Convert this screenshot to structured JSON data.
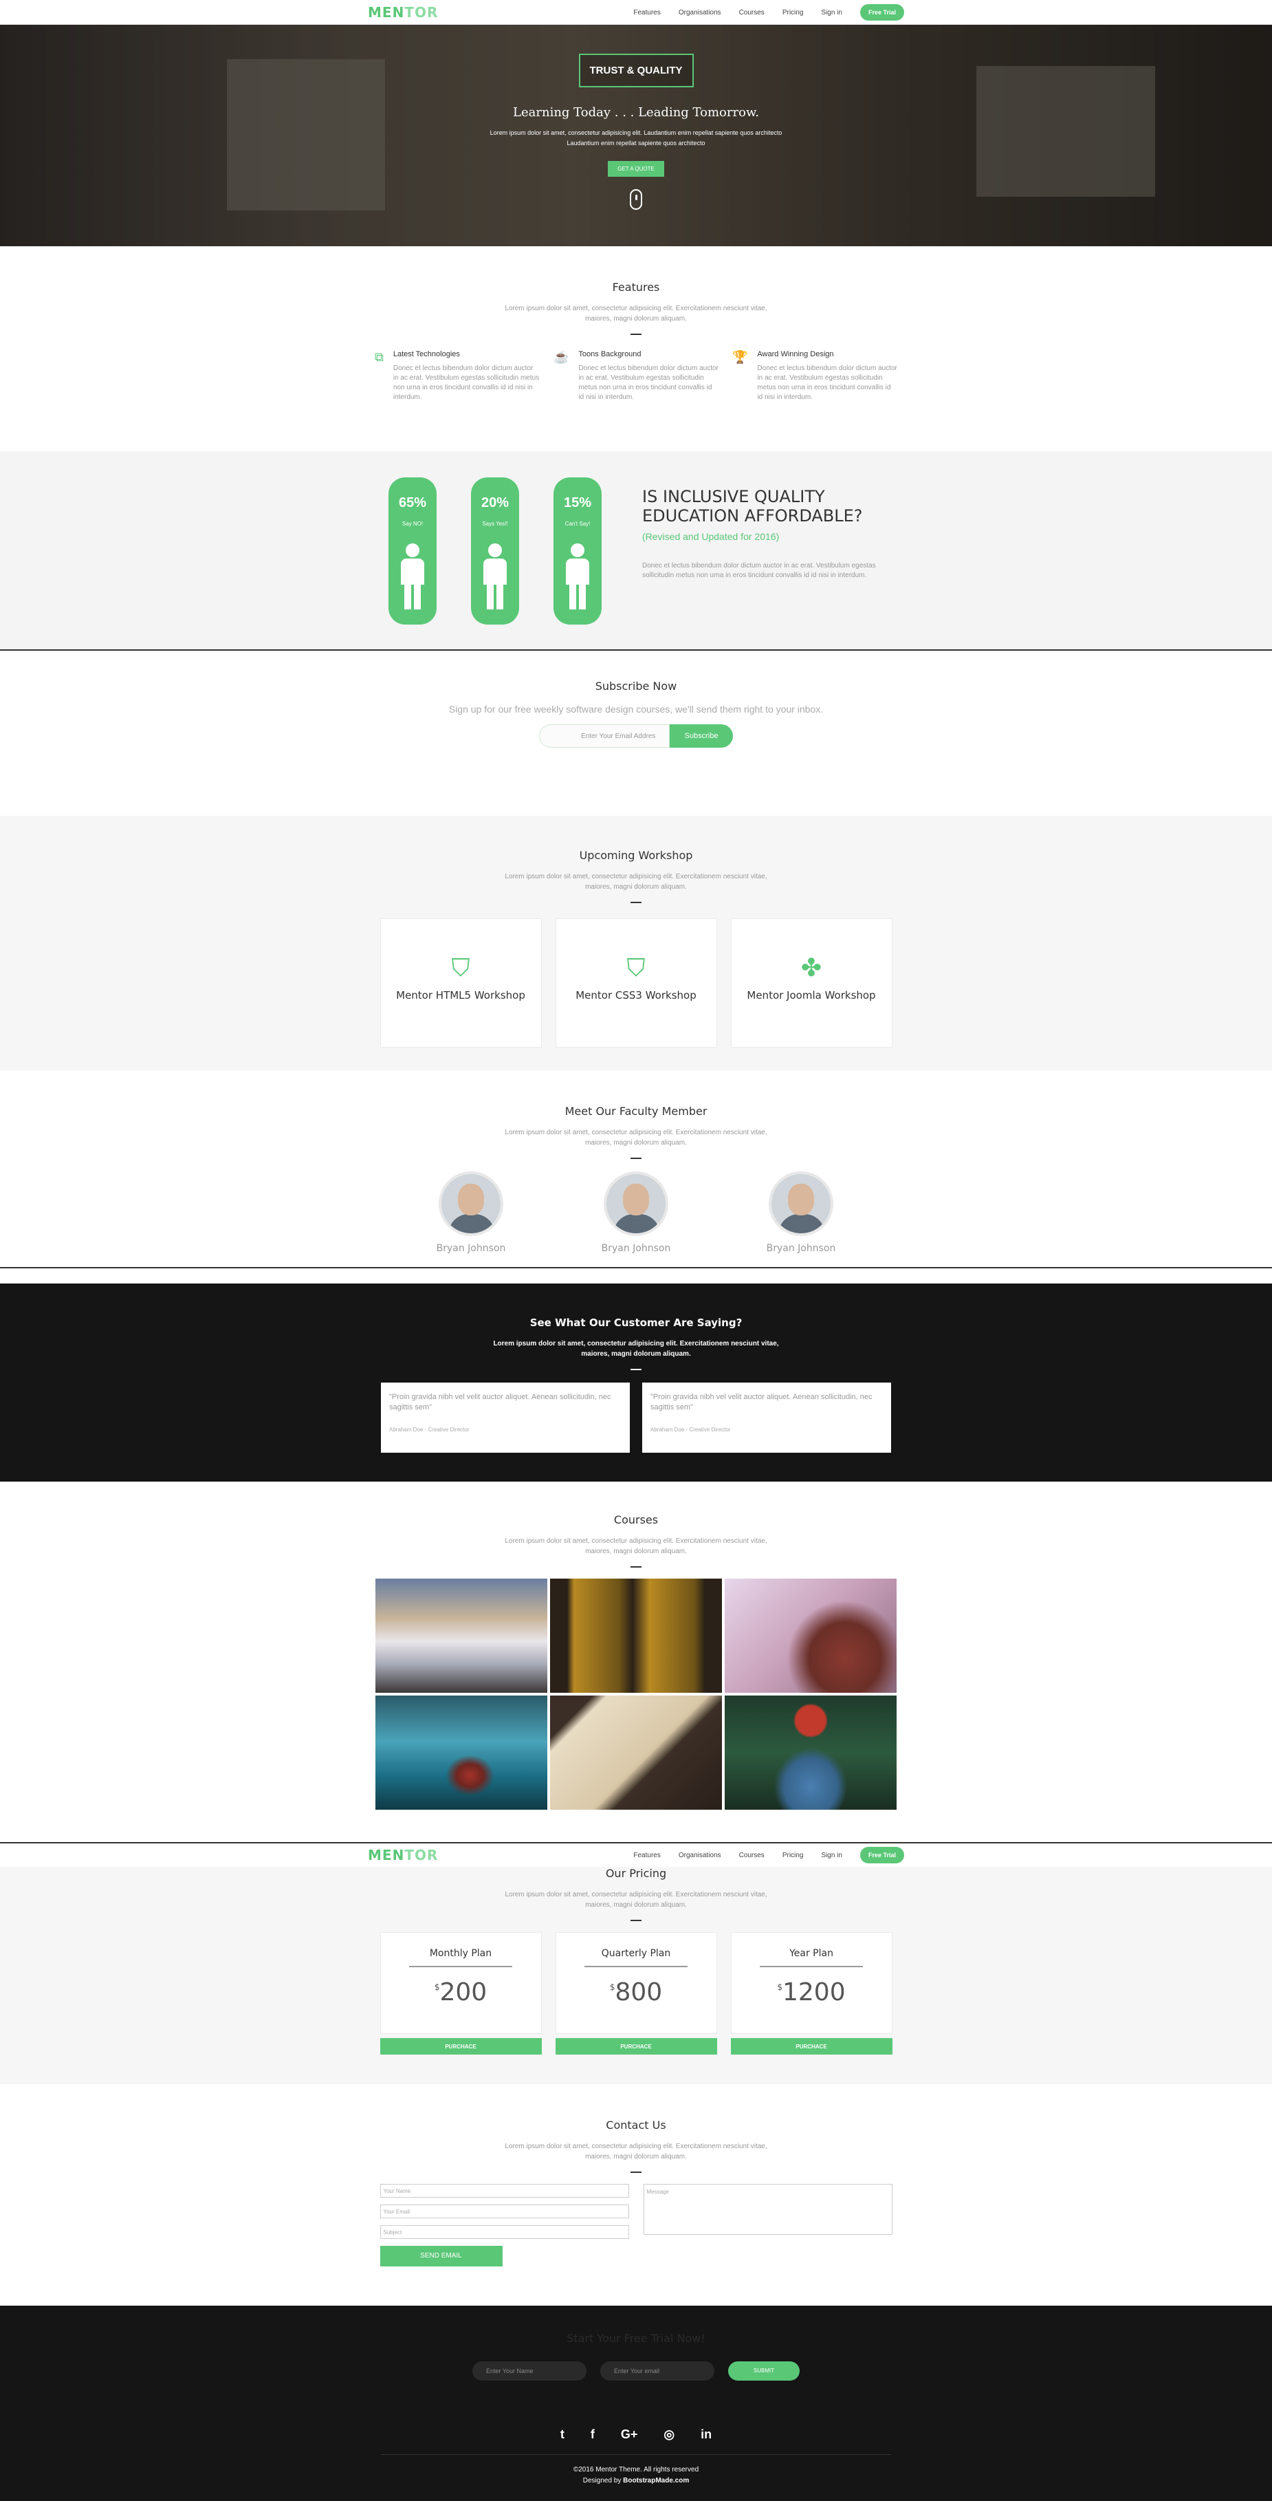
{
  "nav": {
    "logo_a": "MEN",
    "logo_b": "TOR",
    "items": [
      "Features",
      "Organisations",
      "Courses",
      "Pricing",
      "Sign in"
    ],
    "cta": "Free Trial"
  },
  "hero": {
    "badge": "TRUST & QUALITY",
    "headline": "Learning Today . . . Leading Tomorrow.",
    "text1": "Lorem ipsum dolor sit amet, consectetur adipisicing elit. Laudantium enim repellat sapiente quos architecto",
    "text2": "Laudantium enim repellat sapiente quos architecto",
    "button": "GET A QUOTE"
  },
  "features": {
    "title": "Features",
    "sub1": "Lorem ipsum dolor sit amet, consectetur adipisicing elit. Exercitationem nesciunt vitae,",
    "sub2": "maiores, magni dolorum aliquam.",
    "items": [
      {
        "icon": "css3-icon",
        "title": "Latest Technologies",
        "text": "Donec et lectus bibendum dolor dictum auctor in ac erat. Vestibulum egestas sollicitudin metus non urna in eros tincidunt convallis id id nisi in interdum."
      },
      {
        "icon": "drink-icon",
        "title": "Toons Background",
        "text": "Donec et lectus bibendum dolor dictum auctor in ac erat. Vestibulum egestas sollicitudin metus non urna in eros tincidunt convallis id id nisi in interdum."
      },
      {
        "icon": "trophy-icon",
        "title": "Award Winning Design",
        "text": "Donec et lectus bibendum dolor dictum auctor in ac erat. Vestibulum egestas sollicitudin metus non urna in eros tincidunt convallis id id nisi in interdum."
      }
    ]
  },
  "stats": {
    "items": [
      {
        "pct": "65%",
        "label": "Say NO!"
      },
      {
        "pct": "20%",
        "label": "Says Yes!!"
      },
      {
        "pct": "15%",
        "label": "Can't Say!"
      }
    ],
    "heading1": "IS INCLUSIVE QUALITY",
    "heading2": "EDUCATION AFFORDABLE?",
    "sub": "(Revised and Updated for 2016)",
    "text": "Donec et lectus bibendum dolor dictum auctor in ac erat. Vestibulum egestas sollicitudin metus non urna in eros tincidunt convallis id id nisi in interdum."
  },
  "subscribe": {
    "title": "Subscribe Now",
    "lead": "Sign up for our free weekly software design courses, we'll send them right to your inbox.",
    "placeholder": "Enter Your Email Addres",
    "button": "Subscribe"
  },
  "workshop": {
    "title": "Upcoming Workshop",
    "sub1": "Lorem ipsum dolor sit amet, consectetur adipisicing elit. Exercitationem nesciunt vitae,",
    "sub2": "maiores, magni dolorum aliquam.",
    "cards": [
      {
        "icon": "html5-icon",
        "title": "Mentor HTML5 Workshop"
      },
      {
        "icon": "css3-icon",
        "title": "Mentor CSS3 Workshop"
      },
      {
        "icon": "joomla-icon",
        "title": "Mentor Joomla Workshop"
      }
    ]
  },
  "faculty": {
    "title": "Meet Our Faculty Member",
    "sub1": "Lorem ipsum dolor sit amet, consectetur adipisicing elit. Exercitationem nesciunt vitae,",
    "sub2": "maiores, magni dolorum aliquam.",
    "members": [
      "Bryan Johnson",
      "Bryan Johnson",
      "Bryan Johnson"
    ]
  },
  "testimonials": {
    "title": "See What Our Customer Are Saying?",
    "sub1": "Lorem ipsum dolor sit amet, consectetur adipisicing elit. Exercitationem nesciunt vitae,",
    "sub2": "maiores, magni dolorum aliquam.",
    "cards": [
      {
        "quote": "\"Proin gravida nibh vel velit auctor aliquet. Aenean sollicitudin, nec sagittis sem\"",
        "by": "Abraham Doe - Creative Director"
      },
      {
        "quote": "\"Proin gravida nibh vel velit auctor aliquet. Aenean sollicitudin, nec sagittis sem\"",
        "by": "Abraham Doe - Creative Director"
      }
    ]
  },
  "courses": {
    "title": "Courses",
    "sub1": "Lorem ipsum dolor sit amet, consectetur adipisicing elit. Exercitationem nesciunt vitae,",
    "sub2": "maiores, magni dolorum aliquam."
  },
  "pricing": {
    "title": "Our Pricing",
    "sub1": "Lorem ipsum dolor sit amet, consectetur adipisicing elit. Exercitationem nesciunt vitae,",
    "sub2": "maiores, magni dolorum aliquam.",
    "currency": "$",
    "plans": [
      {
        "name": "Monthly Plan",
        "price": "200",
        "button": "PURCHACE"
      },
      {
        "name": "Quarterly Plan",
        "price": "800",
        "button": "PURCHACE"
      },
      {
        "name": "Year Plan",
        "price": "1200",
        "button": "PURCHACE"
      }
    ]
  },
  "contact": {
    "title": "Contact Us",
    "sub1": "Lorem ipsum dolor sit amet, consectetur adipisicing elit. Exercitationem nesciunt vitae,",
    "sub2": "maiores, magni dolorum aliquam.",
    "name_ph": "Your Name",
    "email_ph": "Your Email",
    "subject_ph": "Subject",
    "message_ph": "Message",
    "button": "SEND EMAIL"
  },
  "footer": {
    "cta": "Start Your Free Trial Now!",
    "name_ph": "Enter Your Name",
    "email_ph": "Enter Your email",
    "button": "SUBMIT",
    "social": [
      {
        "icon": "twitter-icon",
        "glyph": "t"
      },
      {
        "icon": "facebook-icon",
        "glyph": "f"
      },
      {
        "icon": "google-plus-icon",
        "glyph": "G+"
      },
      {
        "icon": "dribbble-icon",
        "glyph": "◎"
      },
      {
        "icon": "linkedin-icon",
        "glyph": "in"
      }
    ],
    "copyright": "©2016 Mentor Theme. All rights reserved",
    "designed_prefix": "Designed by",
    "designed_by": "BootstrapMade.com"
  },
  "colors": {
    "accent": "#5ac777",
    "dark": "#151515",
    "light_bg": "#f6f6f6"
  }
}
